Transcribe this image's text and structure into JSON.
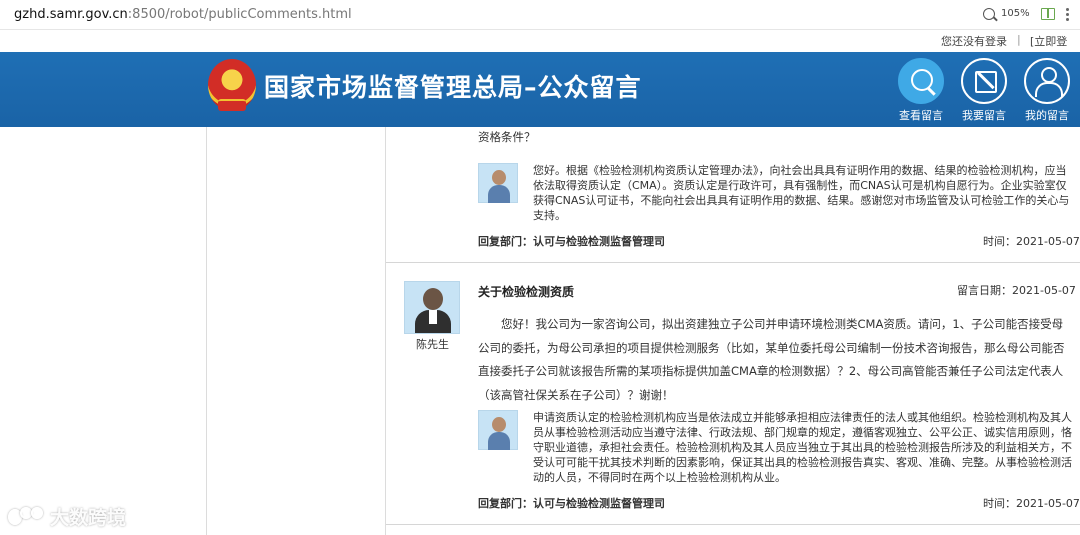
{
  "browser": {
    "url_host": "gzhd.samr.gov.cn",
    "url_rest": ":8500/robot/publicComments.html",
    "zoom": "105%"
  },
  "topbar": {
    "not_logged_in": "您还没有登录",
    "separator": "|",
    "login_link": "[立即登录]"
  },
  "header": {
    "site_title": "国家市场监督管理总局–公众留言",
    "nav": [
      {
        "label": "查看留言",
        "icon": "search-icon",
        "active": true
      },
      {
        "label": "我要留言",
        "icon": "edit-icon",
        "active": false
      },
      {
        "label": "我的留言",
        "icon": "user-icon",
        "active": false
      }
    ],
    "colors": {
      "header_bg": "#1f6fb5",
      "active_nav": "#3fa9e6"
    }
  },
  "comments": [
    {
      "question_tail": "资格条件？",
      "reply": {
        "text": "您好。根据《检验检测机构资质认定管理办法》，向社会出具具有证明作用的数据、结果的检验检测机构，应当依法取得资质认定（CMA）。资质认定是行政许可，具有强制性，而CNAS认可是机构自愿行为。企业实验室仅获得CNAS认可证书，不能向社会出具具有证明作用的数据、结果。感谢您对市场监管及认可检验工作的关心与支持。",
        "dept": "回复部门：认可与检验检测监督管理司",
        "time": "时间：2021-05-07"
      }
    },
    {
      "poster": "陈先生",
      "title": "关于检验检测资质",
      "date": "留言日期：2021-05-07",
      "body": "您好！我公司为一家咨询公司，拟出资建独立子公司并申请环境检测类CMA资质。请问，1、子公司能否接受母公司的委托，为母公司承担的项目提供检测服务（比如，某单位委托母公司编制一份技术咨询报告，那么母公司能否直接委托子公司就该报告所需的某项指标提供加盖CMA章的检测数据）？2、母公司高管能否兼任子公司法定代表人（该高管社保关系在子公司）？谢谢！",
      "reply": {
        "text": "申请资质认定的检验检测机构应当是依法成立并能够承担相应法律责任的法人或其他组织。检验检测机构及其人员从事检验检测活动应当遵守法律、行政法规、部门规章的规定，遵循客观独立、公平公正、诚实信用原则，恪守职业道德，承担社会责任。检验检测机构及其人员应当独立于其出具的检验检测报告所涉及的利益相关方，不受认可可能干扰其技术判断的因素影响，保证其出具的检验检测报告真实、客观、准确、完整。从事检验检测活动的人员，不得同时在两个以上检验检测机构从业。",
        "dept": "回复部门：认可与检验检测监督管理司",
        "time": "时间：2021-05-07"
      }
    }
  ],
  "watermark": "大数跨境"
}
